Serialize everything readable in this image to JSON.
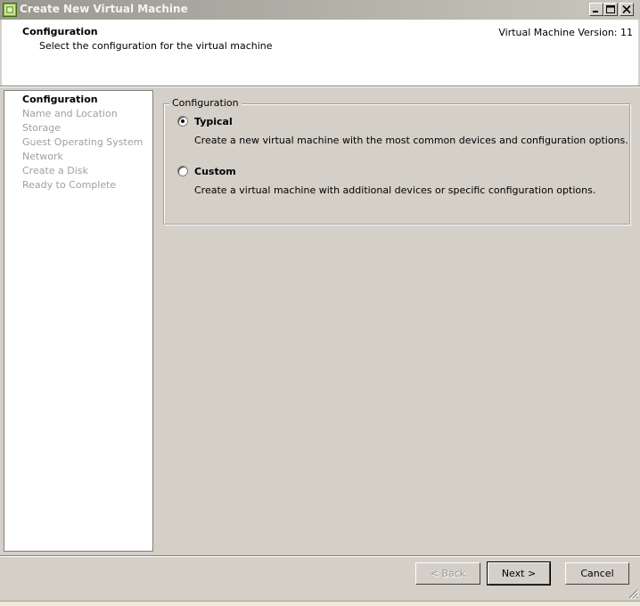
{
  "window": {
    "title": "Create New Virtual Machine"
  },
  "header": {
    "title": "Configuration",
    "subtitle": "Select the configuration for the virtual machine",
    "version": "Virtual Machine Version: 11"
  },
  "sidebar": {
    "steps": [
      {
        "label": "Configuration",
        "active": true
      },
      {
        "label": "Name and Location",
        "active": false
      },
      {
        "label": "Storage",
        "active": false
      },
      {
        "label": "Guest Operating System",
        "active": false
      },
      {
        "label": "Network",
        "active": false
      },
      {
        "label": "Create a Disk",
        "active": false
      },
      {
        "label": "Ready to Complete",
        "active": false
      }
    ]
  },
  "main": {
    "group_label": "Configuration",
    "options": [
      {
        "label": "Typical",
        "description": "Create a new virtual machine with the most common devices and configuration options.",
        "selected": true
      },
      {
        "label": "Custom",
        "description": "Create a virtual machine with additional devices or specific configuration options.",
        "selected": false
      }
    ]
  },
  "footer": {
    "back_label": "< Back",
    "next_label": "Next >",
    "cancel_label": "Cancel"
  },
  "colors": {
    "dialog_bg": "#d4d0c8",
    "panel_bg": "#ffffff",
    "disabled_text": "#a0a0a0"
  }
}
